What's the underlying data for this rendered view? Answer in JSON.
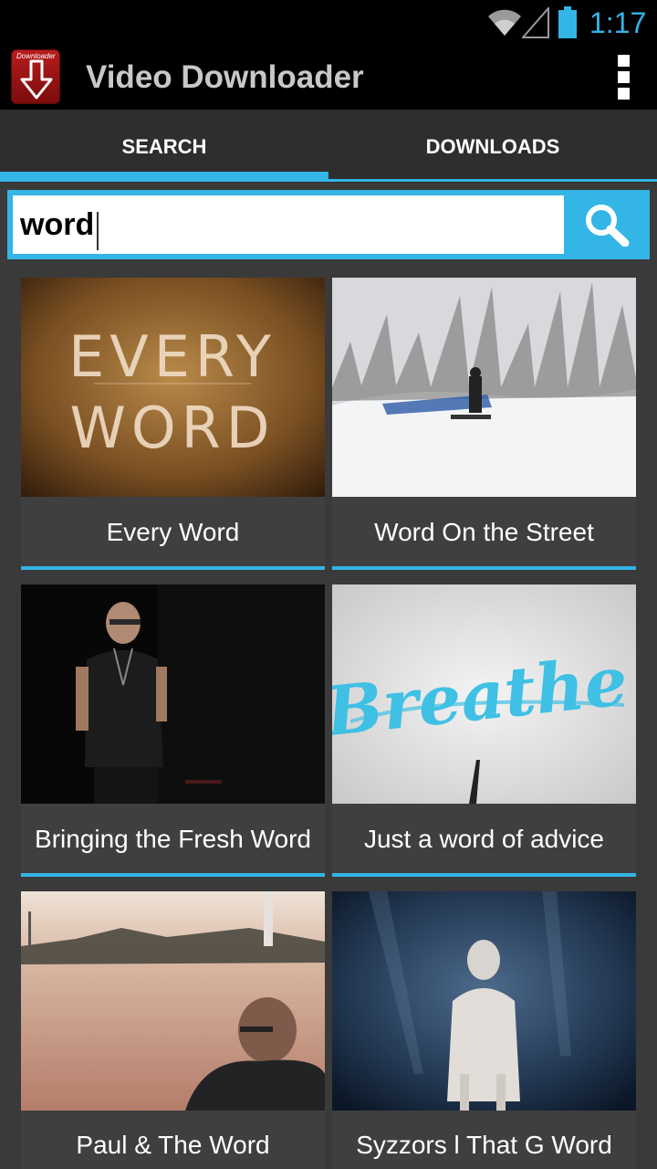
{
  "status_bar": {
    "time": "1:17"
  },
  "app": {
    "title": "Video Downloader",
    "icon_text": "Downloader"
  },
  "tabs": [
    {
      "label": "SEARCH"
    },
    {
      "label": "DOWNLOADS"
    }
  ],
  "search": {
    "value": "word"
  },
  "results": [
    {
      "title": "Every Word",
      "thumb_text": [
        "EVERY",
        "WORD"
      ]
    },
    {
      "title": "Word On the Street"
    },
    {
      "title": "Bringing the Fresh Word"
    },
    {
      "title": "Just a word of advice",
      "thumb_text": "Breathe"
    },
    {
      "title": "Paul & The Word"
    },
    {
      "title": "Syzzors l That G Word"
    }
  ],
  "colors": {
    "accent": "#33b5e5",
    "app_icon": "#b81d1d"
  }
}
